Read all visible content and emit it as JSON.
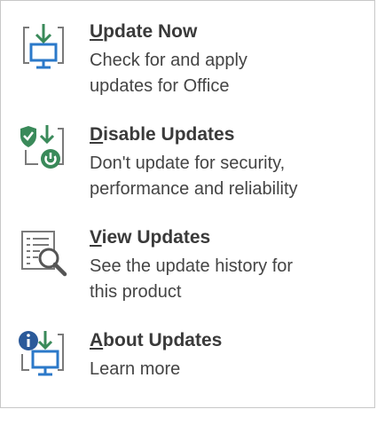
{
  "menu": {
    "items": [
      {
        "title_mnemonic": "U",
        "title_rest": "pdate Now",
        "description": "Check for and apply\nupdates for Office",
        "icon": "update-now-icon"
      },
      {
        "title_mnemonic": "D",
        "title_rest": "isable Updates",
        "description": "Don't update for security,\nperformance and reliability",
        "icon": "disable-updates-icon"
      },
      {
        "title_mnemonic": "V",
        "title_rest": "iew Updates",
        "description": "See the update history for\nthis product",
        "icon": "view-updates-icon"
      },
      {
        "title_mnemonic": "A",
        "title_rest": "bout Updates",
        "description": "Learn more",
        "icon": "about-updates-icon"
      }
    ]
  },
  "colors": {
    "icon_blue": "#2b79c9",
    "icon_green": "#3a8a5a",
    "icon_gray": "#7a7a7a",
    "title_text": "#3a3a3a",
    "body_text": "#444444"
  }
}
